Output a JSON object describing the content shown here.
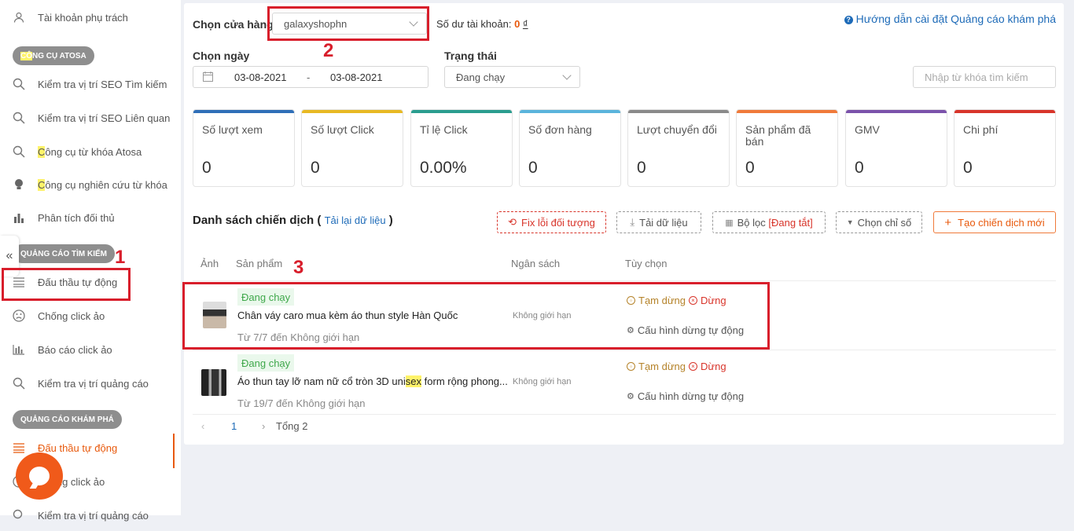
{
  "sidebar": {
    "top_item": "Tài khoản phụ trách",
    "section_tools": "CÔNG CỤ ATOSA",
    "tools": [
      {
        "label": "Kiểm tra vị trí SEO Tìm kiếm",
        "icon": "search-icon"
      },
      {
        "label": "Kiểm tra vị trí SEO Liên quan",
        "icon": "search-icon"
      },
      {
        "label": "Công cụ từ khóa Atosa",
        "icon": "search-icon"
      },
      {
        "label": "Công cụ nghiên cứu từ khóa",
        "icon": "lightbulb-icon"
      },
      {
        "label": "Phân tích đối thủ",
        "icon": "bar-chart-icon"
      }
    ],
    "section_search_ads": "QUẢNG CÁO TÌM KIẾM",
    "search_ads": [
      {
        "label": "Đấu thầu tự động",
        "icon": "list-icon"
      },
      {
        "label": "Chống click ảo",
        "icon": "frown-icon"
      },
      {
        "label": "Báo cáo click ảo",
        "icon": "bar-chart-icon"
      },
      {
        "label": "Kiểm tra vị trí quảng cáo",
        "icon": "search-icon"
      }
    ],
    "section_discovery_ads": "QUẢNG CÁO KHÁM PHÁ",
    "discovery_ads": [
      {
        "label": "Đấu thầu tự động",
        "icon": "list-icon",
        "active": true
      },
      {
        "label": "Chống click ảo",
        "icon": "frown-icon"
      },
      {
        "label": "Kiểm tra vị trí quảng cáo",
        "icon": "search-icon"
      }
    ]
  },
  "header": {
    "store_label": "Chọn cửa hàng",
    "store_value": "galaxyshophn",
    "balance_label": "Số dư tài khoản:",
    "balance_value": "0",
    "balance_currency": "₫",
    "help_link": "Hướng dẫn cài đặt Quảng cáo khám phá",
    "date_label": "Chọn ngày",
    "date_from": "03-08-2021",
    "date_sep": "-",
    "date_to": "03-08-2021",
    "status_label": "Trạng thái",
    "status_value": "Đang chạy",
    "search_placeholder": "Nhập từ khóa tìm kiếm"
  },
  "stats": [
    {
      "label": "Số lượt xem",
      "value": "0",
      "color": "#2f6fb8"
    },
    {
      "label": "Số lượt Click",
      "value": "0",
      "color": "#e8b923"
    },
    {
      "label": "Tỉ lệ Click",
      "value": "0.00%",
      "color": "#2a9d8f"
    },
    {
      "label": "Số đơn hàng",
      "value": "0",
      "color": "#5ab4dc"
    },
    {
      "label": "Lượt chuyển đổi",
      "value": "0",
      "color": "#8a8a8a"
    },
    {
      "label": "Sản phẩm đã bán",
      "value": "0",
      "color": "#f07a3a"
    },
    {
      "label": "GMV",
      "value": "0",
      "color": "#7b52ab"
    },
    {
      "label": "Chi phí",
      "value": "0",
      "color": "#d8342a"
    }
  ],
  "campaigns": {
    "title": "Danh sách chiến dịch",
    "reload_link": "Tải lại dữ liệu",
    "buttons": {
      "fix": "Fix lỗi đối tượng",
      "download": "Tải dữ liệu",
      "filter": "Bộ lọc",
      "filter_state": "[Đang tắt]",
      "choose_metrics": "Chọn chỉ số",
      "create": "Tạo chiến dịch mới"
    },
    "columns": {
      "image": "Ảnh",
      "product": "Sản phẩm",
      "budget": "Ngân sách",
      "options": "Tùy chọn"
    },
    "rows": [
      {
        "status": "Đang chạy",
        "name": "Chân váy caro mua kèm áo thun style Hàn Quốc",
        "date": "Từ 7/7 đến Không giới hạn",
        "budget": "Không giới hạn",
        "pause": "Tạm dừng",
        "stop": "Dừng",
        "auto_config": "Cấu hình dừng tự động"
      },
      {
        "status": "Đang chạy",
        "name_before": "Áo thun tay lỡ nam nữ cổ tròn 3D uni",
        "name_highlight": "sex",
        "name_after": " form rộng phong...",
        "date": "Từ 19/7 đến Không giới hạn",
        "budget": "Không giới hạn",
        "pause": "Tạm dừng",
        "stop": "Dừng",
        "auto_config": "Cấu hình dừng tự động"
      }
    ],
    "pagination": {
      "current": "1",
      "total": "Tổng 2"
    }
  },
  "annotations": [
    "1",
    "2",
    "3"
  ],
  "colors": {
    "accent": "#e8590c",
    "annotation": "#d81e2b",
    "link": "#1e6bb8"
  }
}
